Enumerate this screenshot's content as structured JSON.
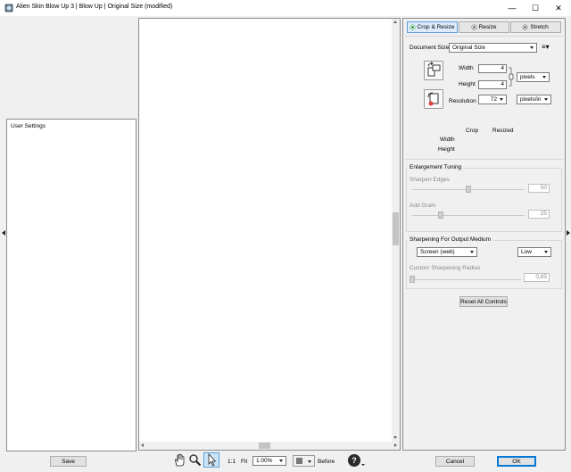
{
  "window": {
    "title": "Alien Skin Blow Up 3 | Blow Up | Original Size (modified)",
    "minimize_glyph": "—",
    "maximize_glyph": "☐",
    "close_glyph": "✕"
  },
  "left_panel": {
    "user_settings_label": "User Settings",
    "save_label": "Save"
  },
  "tabs": [
    {
      "label": "Crop & Resize",
      "icon": "green-dot-icon",
      "active": true
    },
    {
      "label": "Resize",
      "icon": "dot-icon",
      "active": false
    },
    {
      "label": "Stretch",
      "icon": "dot-icon",
      "active": false
    }
  ],
  "crop_resize": {
    "document_size_label": "Document Size",
    "document_size_value": "Original Size",
    "menu_glyph": "≡▾",
    "width_label": "Width",
    "width_value": "4",
    "height_label": "Height",
    "height_value": "4",
    "unit_value": "pixels",
    "resolution_label": "Resolution",
    "resolution_value": "72",
    "resolution_unit": "pixels/in",
    "info_header_crop": "Crop",
    "info_header_resized": "Resized",
    "info_width_label": "Width",
    "info_height_label": "Height"
  },
  "enlargement_tuning": {
    "title": "Enlargement Tuning",
    "sharpen_edges_label": "Sharpen Edges",
    "sharpen_edges_value": "50",
    "sharpen_edges_level": 0.5,
    "add_grain_label": "Add Grain",
    "add_grain_value": "25",
    "add_grain_level": 0.25
  },
  "sharpening_output": {
    "title": "Sharpening For Output Medium",
    "medium_value": "Screen (web)",
    "amount_value": "Low",
    "radius_label": "Custom Sharpening Radius",
    "radius_value": "0,85",
    "radius_level": 0.0
  },
  "reset_all_label": "Reset All Controls",
  "toolbar": {
    "one_to_one_label": "1:1",
    "fit_label": "Fit",
    "zoom_value": "1.00%",
    "before_label": "Before",
    "help_glyph": "?",
    "cancel_label": "Cancel",
    "ok_label": "OK"
  },
  "colors": {
    "accent": "#0078d7",
    "active_tab_bg": "#dcecfc",
    "green_dot": "#3ba04e"
  }
}
